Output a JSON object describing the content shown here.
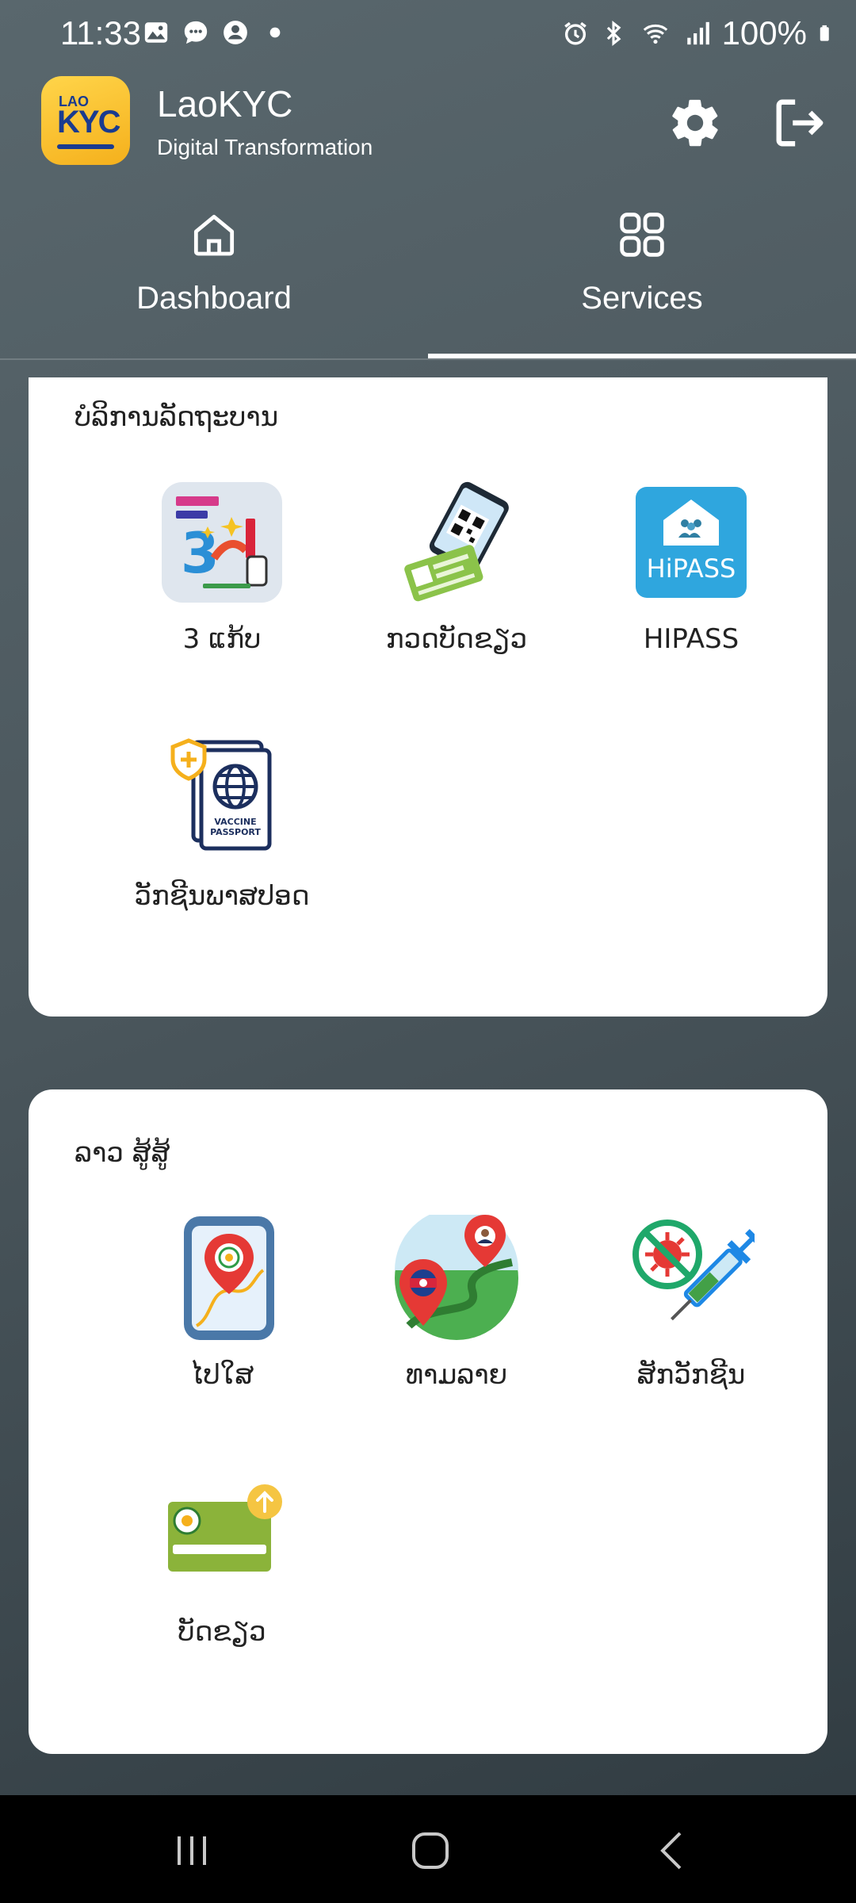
{
  "status_bar": {
    "time": "11:33",
    "battery": "100%",
    "left_icons": [
      "gallery-icon",
      "message-icon",
      "account-icon",
      "dot-icon"
    ],
    "right_icons": [
      "alarm-icon",
      "bluetooth-icon",
      "wifi-icon",
      "signal-icon",
      "battery-icon"
    ]
  },
  "header": {
    "logo_text_top": "LAO",
    "logo_text_main": "KYC",
    "title": "LaoKYC",
    "subtitle": "Digital Transformation",
    "settings_icon": "gear-icon",
    "logout_icon": "logout-icon"
  },
  "tabs": [
    {
      "label": "Dashboard",
      "icon": "home-icon",
      "active": false
    },
    {
      "label": "Services",
      "icon": "grid-icon",
      "active": true
    }
  ],
  "sections": [
    {
      "title": "ບໍລິການລັດຖະບານ",
      "items": [
        {
          "label": "3 ແກ້ບ",
          "icon": "3-kaeb-app-icon"
        },
        {
          "label": "ກວດບັດຂຽວ",
          "icon": "phone-qr-scan-icon"
        },
        {
          "label": "HIPASS",
          "icon": "hipass-icon",
          "icon_text": "HiPASS"
        },
        {
          "label": "ວັກຊີນພາສປອດ",
          "icon": "vaccine-passport-icon",
          "icon_text_1": "VACCINE",
          "icon_text_2": "PASSPORT"
        }
      ]
    },
    {
      "title": "ລາວ ສູ້ສູ້",
      "items": [
        {
          "label": "ໄປໃສ",
          "icon": "map-location-phone-icon"
        },
        {
          "label": "ທາມລາຍ",
          "icon": "route-map-icon"
        },
        {
          "label": "ສັກວັກຊີນ",
          "icon": "vaccine-syringe-icon"
        },
        {
          "label": "ບັດຂຽວ",
          "icon": "green-card-icon"
        }
      ]
    }
  ],
  "colors": {
    "background": "#4f5c62",
    "card": "#ffffff",
    "logo": "#f5b01c",
    "hipass": "#2fa6de",
    "pin_red": "#e53935",
    "green": "#8bb33a"
  },
  "nav_bar": [
    "recent-apps-icon",
    "home-button-icon",
    "back-icon"
  ]
}
